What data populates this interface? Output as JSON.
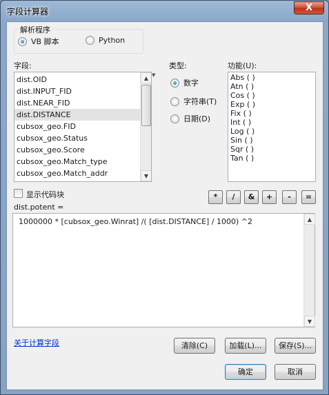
{
  "window": {
    "title": "字段计算器",
    "close_label": "X"
  },
  "parser": {
    "group_title": "解析程序",
    "options": [
      {
        "label": "VB 脚本",
        "selected": true
      },
      {
        "label": "Python",
        "selected": false
      }
    ]
  },
  "fields": {
    "label": "字段:",
    "items": [
      "dist.OID",
      "dist.INPUT_FID",
      "dist.NEAR_FID",
      "dist.DISTANCE",
      "cubsox_geo.FID",
      "cubsox_geo.Status",
      "cubsox_geo.Score",
      "cubsox_geo.Match_type",
      "cubsox_geo.Match_addr"
    ],
    "selected_index": 3
  },
  "types": {
    "label": "类型:",
    "options": [
      {
        "label": "数字",
        "selected": true
      },
      {
        "label": "字符串(T)",
        "selected": false
      },
      {
        "label": "日期(D)",
        "selected": false
      }
    ]
  },
  "functions": {
    "label": "功能(U):",
    "items": [
      "Abs ( )",
      "Atn ( )",
      "Cos ( )",
      "Exp ( )",
      "Fix ( )",
      "Int ( )",
      "Log ( )",
      "Sin ( )",
      "Sqr ( )",
      "Tan ( )"
    ]
  },
  "show_codeblock": {
    "label": "显示代码块",
    "checked": false
  },
  "operators": [
    "*",
    "/",
    "&",
    "+",
    "-",
    "="
  ],
  "expression": {
    "label": "dist.potent =",
    "value": "1000000 * [cubsox_geo.Winrat] /( [dist.DISTANCE] / 1000) ^2"
  },
  "footer": {
    "help_link": "关于计算字段",
    "clear": "清除(C)",
    "load": "加载(L)...",
    "save": "保存(S)...",
    "ok": "确定",
    "cancel": "取消"
  }
}
